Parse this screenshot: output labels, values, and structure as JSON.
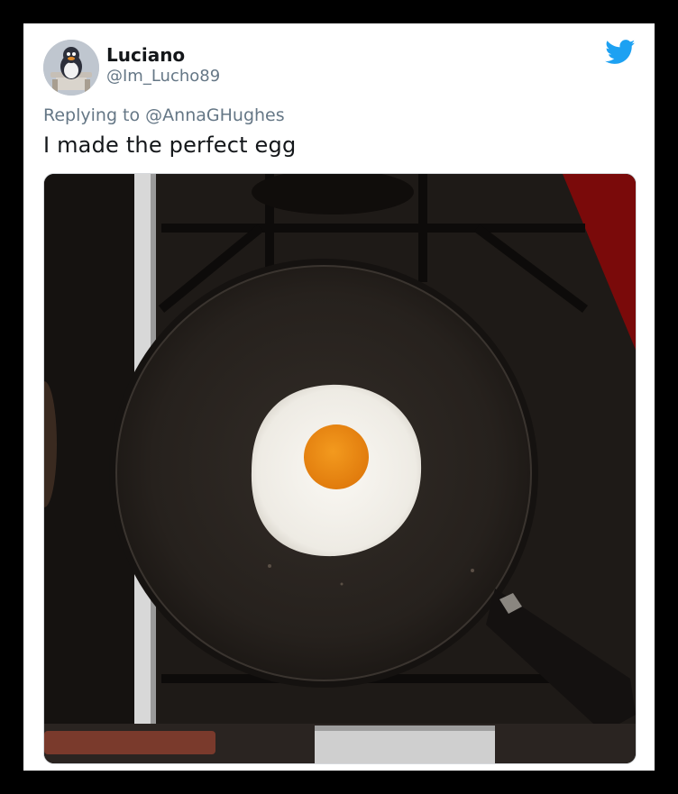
{
  "tweet": {
    "author_name": "Luciano",
    "author_handle": "@Im_Lucho89",
    "reply_prefix": "Replying to",
    "reply_to": "@AnnaGHughes",
    "text": "I made the perfect egg"
  },
  "icons": {
    "brand": "twitter-bird-icon",
    "avatar": "penguin-avatar"
  },
  "colors": {
    "brand_blue": "#1da1f2",
    "text_primary": "#14171a",
    "text_secondary": "#657786",
    "yolk": "#f08a12",
    "egg_white": "#f1efe9",
    "pan": "#2b2622"
  },
  "photo": {
    "subject": "fried-egg-in-pan"
  }
}
